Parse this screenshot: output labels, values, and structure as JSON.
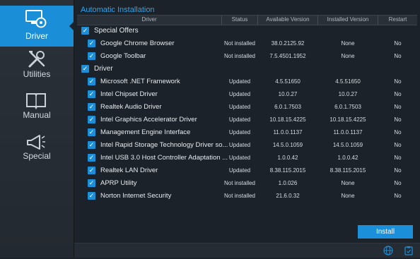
{
  "sidebar": {
    "items": [
      {
        "label": "Driver",
        "icon": "driver-monitor-icon",
        "active": true
      },
      {
        "label": "Utilities",
        "icon": "tools-icon",
        "active": false
      },
      {
        "label": "Manual",
        "icon": "book-icon",
        "active": false
      },
      {
        "label": "Special",
        "icon": "megaphone-icon",
        "active": false
      }
    ]
  },
  "main": {
    "section_title": "Automatic Installation",
    "columns": [
      "Driver",
      "Status",
      "Available Version",
      "Installed Version",
      "Restart"
    ],
    "groups": [
      {
        "label": "Special Offers"
      },
      {
        "label": "Driver"
      }
    ],
    "rows": [
      {
        "name": "Google Chrome Browser",
        "status": "Not installed",
        "available": "38.0.2125.92",
        "installed": "None",
        "restart": "No"
      },
      {
        "name": "Google Toolbar",
        "status": "Not installed",
        "available": "7.5.4501.1952",
        "installed": "None",
        "restart": "No"
      },
      {
        "name": "Microsoft .NET Framework",
        "status": "Updated",
        "available": "4.5.51650",
        "installed": "4.5.51650",
        "restart": "No"
      },
      {
        "name": "Intel Chipset Driver",
        "status": "Updated",
        "available": "10.0.27",
        "installed": "10.0.27",
        "restart": "No"
      },
      {
        "name": "Realtek Audio Driver",
        "status": "Updated",
        "available": "6.0.1.7503",
        "installed": "6.0.1.7503",
        "restart": "No"
      },
      {
        "name": "Intel Graphics Accelerator Driver",
        "status": "Updated",
        "available": "10.18.15.4225",
        "installed": "10.18.15.4225",
        "restart": "No"
      },
      {
        "name": "Management Engine Interface",
        "status": "Updated",
        "available": "11.0.0.1137",
        "installed": "11.0.0.1137",
        "restart": "No"
      },
      {
        "name": "Intel Rapid Storage Technology Driver so...",
        "status": "Updated",
        "available": "14.5.0.1059",
        "installed": "14.5.0.1059",
        "restart": "No"
      },
      {
        "name": "Intel USB 3.0 Host Controller Adaptation ...",
        "status": "Updated",
        "available": "1.0.0.42",
        "installed": "1.0.0.42",
        "restart": "No"
      },
      {
        "name": "Realtek LAN Driver",
        "status": "Updated",
        "available": "8.38.115.2015",
        "installed": "8.38.115.2015",
        "restart": "No"
      },
      {
        "name": "APRP Utility",
        "status": "Not installed",
        "available": "1.0.026",
        "installed": "None",
        "restart": "No"
      },
      {
        "name": "Norton Internet Security",
        "status": "Not installed",
        "available": "21.6.0.32",
        "installed": "None",
        "restart": "No"
      }
    ],
    "checkbox_glyph": "✓",
    "install_label": "Install"
  },
  "footer": {
    "icons": [
      "globe-icon",
      "clipboard-icon"
    ]
  },
  "colors": {
    "accent": "#1b8fd9",
    "title_blue": "#2ea3ea",
    "background": "#1c2229"
  }
}
